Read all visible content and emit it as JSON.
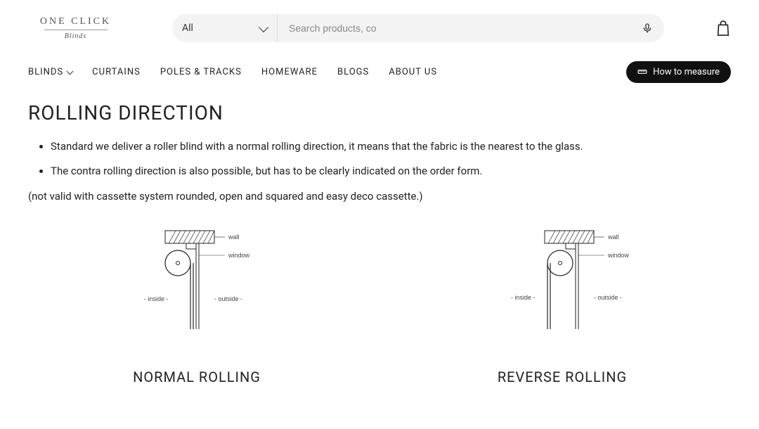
{
  "logo": {
    "top": "ONE CLICK",
    "bottom": "Blinds"
  },
  "search": {
    "category": "All",
    "placeholder": "Search products, co"
  },
  "nav": {
    "blinds": "BLINDS",
    "curtains": "CURTAINS",
    "poles": "POLES & TRACKS",
    "homeware": "HOMEWARE",
    "blogs": "BLOGS",
    "about": "ABOUT US",
    "measure": "How to measure"
  },
  "page": {
    "title": "ROLLING DIRECTION",
    "bullet1": "Standard we deliver a roller blind with a normal rolling direction, it means that the fabric is the nearest to the glass.",
    "bullet2": "The contra rolling direction is also possible, but has to be clearly indicated on the order form.",
    "note": "(not valid with cassette system rounded, open and squared and easy deco cassette.)"
  },
  "diagrams": {
    "normal": {
      "caption": "NORMAL ROLLING",
      "wall": "wall",
      "window": "window",
      "inside": "- inside -",
      "outside": "- outside -"
    },
    "reverse": {
      "caption": "REVERSE ROLLING",
      "wall": "wall",
      "window": "window",
      "inside": "- inside -",
      "outside": "- outside -"
    }
  }
}
